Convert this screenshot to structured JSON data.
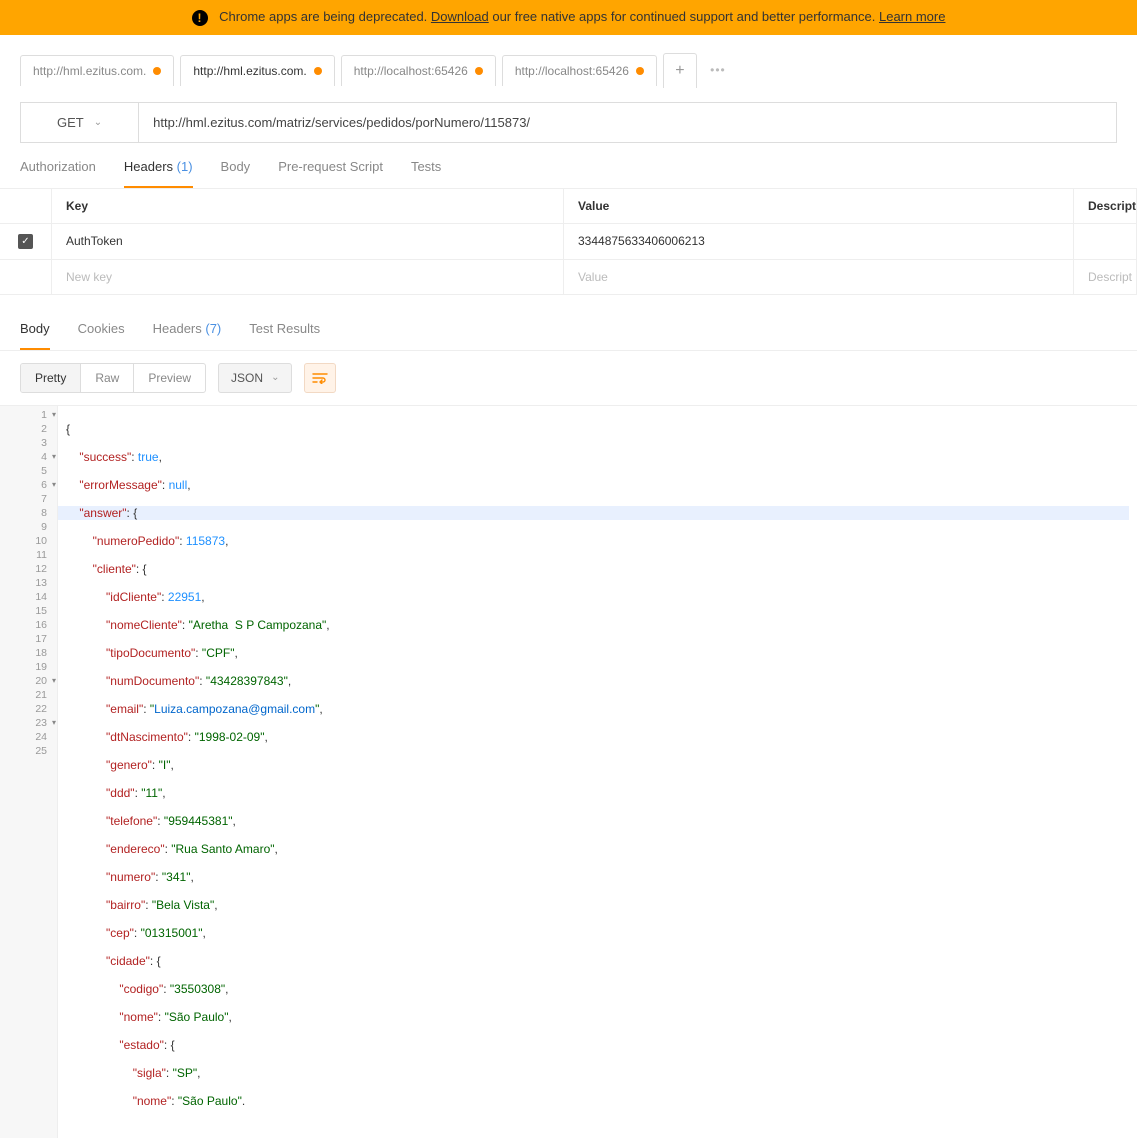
{
  "banner": {
    "text_before": "Chrome apps are being deprecated. ",
    "download_link": "Download",
    "text_mid": " our free native apps for continued support and better performance. ",
    "learn_link": "Learn more"
  },
  "tabs": [
    {
      "label": "http://hml.ezitus.com.",
      "active": false
    },
    {
      "label": "http://hml.ezitus.com.",
      "active": true
    },
    {
      "label": "http://localhost:65426",
      "active": false
    },
    {
      "label": "http://localhost:65426",
      "active": false
    }
  ],
  "request": {
    "method": "GET",
    "url": "http://hml.ezitus.com/matriz/services/pedidos/porNumero/115873/"
  },
  "req_tabs": {
    "authorization": "Authorization",
    "headers": "Headers",
    "headers_count": "(1)",
    "body": "Body",
    "prereq": "Pre-request Script",
    "tests": "Tests"
  },
  "headers_table": {
    "h_key": "Key",
    "h_value": "Value",
    "h_desc": "Descriptio",
    "rows": [
      {
        "key": "AuthToken",
        "value": "3344875633406006213"
      }
    ],
    "new_key": "New key",
    "new_value": "Value",
    "new_desc": "Descript"
  },
  "resp_tabs": {
    "body": "Body",
    "cookies": "Cookies",
    "headers": "Headers",
    "headers_count": "(7)",
    "tests": "Test Results"
  },
  "view_modes": {
    "pretty": "Pretty",
    "raw": "Raw",
    "preview": "Preview",
    "format": "JSON"
  },
  "response_json": {
    "success": true,
    "errorMessage": null,
    "answer": {
      "numeroPedido": 115873,
      "cliente": {
        "idCliente": 22951,
        "nomeCliente": "Aretha  S P Campozana",
        "tipoDocumento": "CPF",
        "numDocumento": "43428397843",
        "email": "Luiza.campozana@gmail.com",
        "dtNascimento": "1998-02-09",
        "genero": "I",
        "ddd": "11",
        "telefone": "959445381",
        "endereco": "Rua Santo Amaro",
        "numero": "341",
        "bairro": "Bela Vista",
        "cep": "01315001",
        "cidade": {
          "codigo": "3550308",
          "nome": "São Paulo",
          "estado": {
            "sigla": "SP",
            "nome": "São Paulo"
          }
        }
      }
    }
  }
}
